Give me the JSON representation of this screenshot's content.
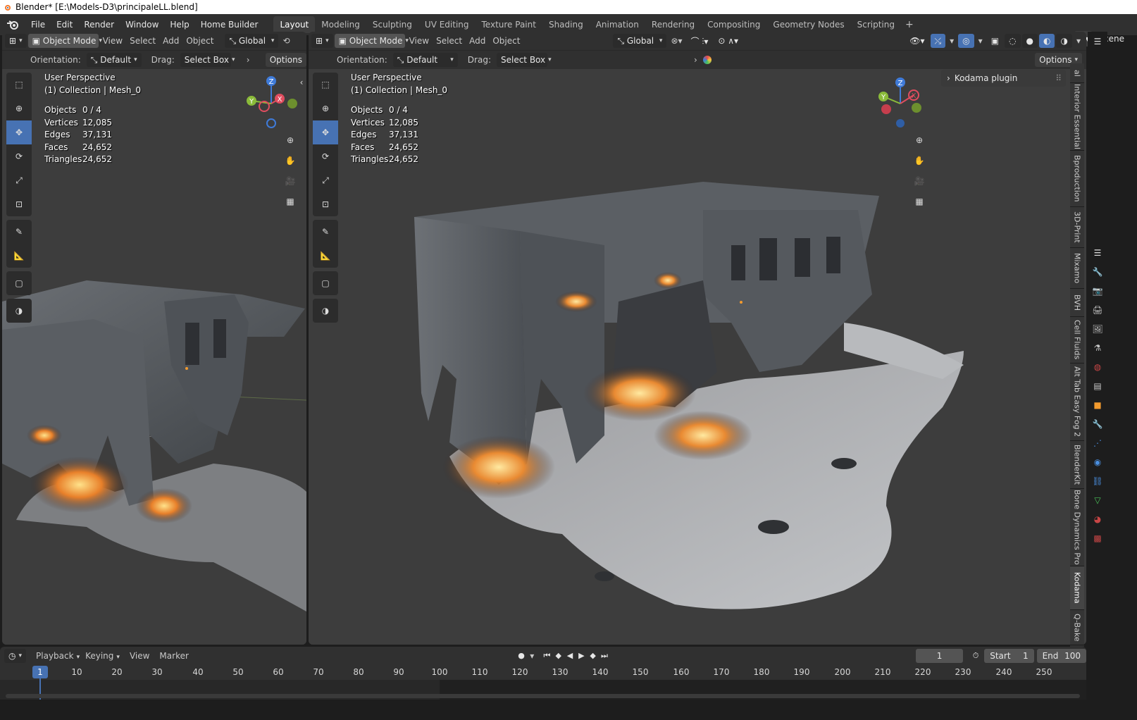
{
  "window": {
    "title": "Blender* [E:\\Models-D3\\principaleLL.blend]"
  },
  "menu": {
    "items": [
      "File",
      "Edit",
      "Render",
      "Window",
      "Help",
      "Home Builder"
    ]
  },
  "workspaces": {
    "tabs": [
      "Layout",
      "Modeling",
      "Sculpting",
      "UV Editing",
      "Texture Paint",
      "Shading",
      "Animation",
      "Rendering",
      "Compositing",
      "Geometry Nodes",
      "Scripting"
    ],
    "active": "Layout",
    "add": "+"
  },
  "scene": {
    "label": "Scene"
  },
  "left_view": {
    "mode": "Object Mode",
    "menus": [
      "View",
      "Select",
      "Add",
      "Object"
    ],
    "orientation_global": "Global",
    "orientation_label": "Orientation:",
    "orientation_value": "Default",
    "drag_label": "Drag:",
    "drag_value": "Select Box",
    "options": "Options",
    "perspective": "User Perspective",
    "collection": "(1) Collection | Mesh_0"
  },
  "right_view": {
    "mode": "Object Mode",
    "menus": [
      "View",
      "Select",
      "Add",
      "Object"
    ],
    "orientation_global": "Global",
    "orientation_label": "Orientation:",
    "orientation_value": "Default",
    "drag_label": "Drag:",
    "drag_value": "Select Box",
    "options": "Options",
    "perspective": "User Perspective",
    "collection": "(1) Collection | Mesh_0",
    "npanel_item": "Kodama plugin"
  },
  "stats": {
    "objects_label": "Objects",
    "objects": "0 / 4",
    "vertices_label": "Vertices",
    "vertices": "12,085",
    "edges_label": "Edges",
    "edges": "37,131",
    "faces_label": "Faces",
    "faces": "24,652",
    "triangles_label": "Triangles",
    "triangles": "24,652"
  },
  "gizmo": {
    "x": "X",
    "y": "Y",
    "z": "Z"
  },
  "side_tabs": [
    "al",
    "Interior Essential",
    "Bproduction",
    "3D-Print",
    "Mixamo",
    "BVH",
    "Cell Fluids",
    "Alt Tab Easy Fog 2",
    "BlenderKit",
    "Bone Dynamics Pro",
    "Kodama",
    "Q-Bake"
  ],
  "timeline": {
    "menus": [
      "Playback",
      "Keying",
      "View",
      "Marker"
    ],
    "current_frame": "1",
    "start_label": "Start",
    "start": "1",
    "end_label": "End",
    "end": "100",
    "ruler": [
      "1",
      "10",
      "20",
      "30",
      "40",
      "50",
      "60",
      "70",
      "80",
      "90",
      "100",
      "110",
      "120",
      "130",
      "140",
      "150",
      "160",
      "170",
      "180",
      "190",
      "200",
      "210",
      "220",
      "230",
      "240",
      "250"
    ]
  },
  "colors": {
    "accent": "#4772b3",
    "x_axis": "#e04d5f",
    "y_axis": "#8bbb3a",
    "z_axis": "#3f7bd9"
  }
}
